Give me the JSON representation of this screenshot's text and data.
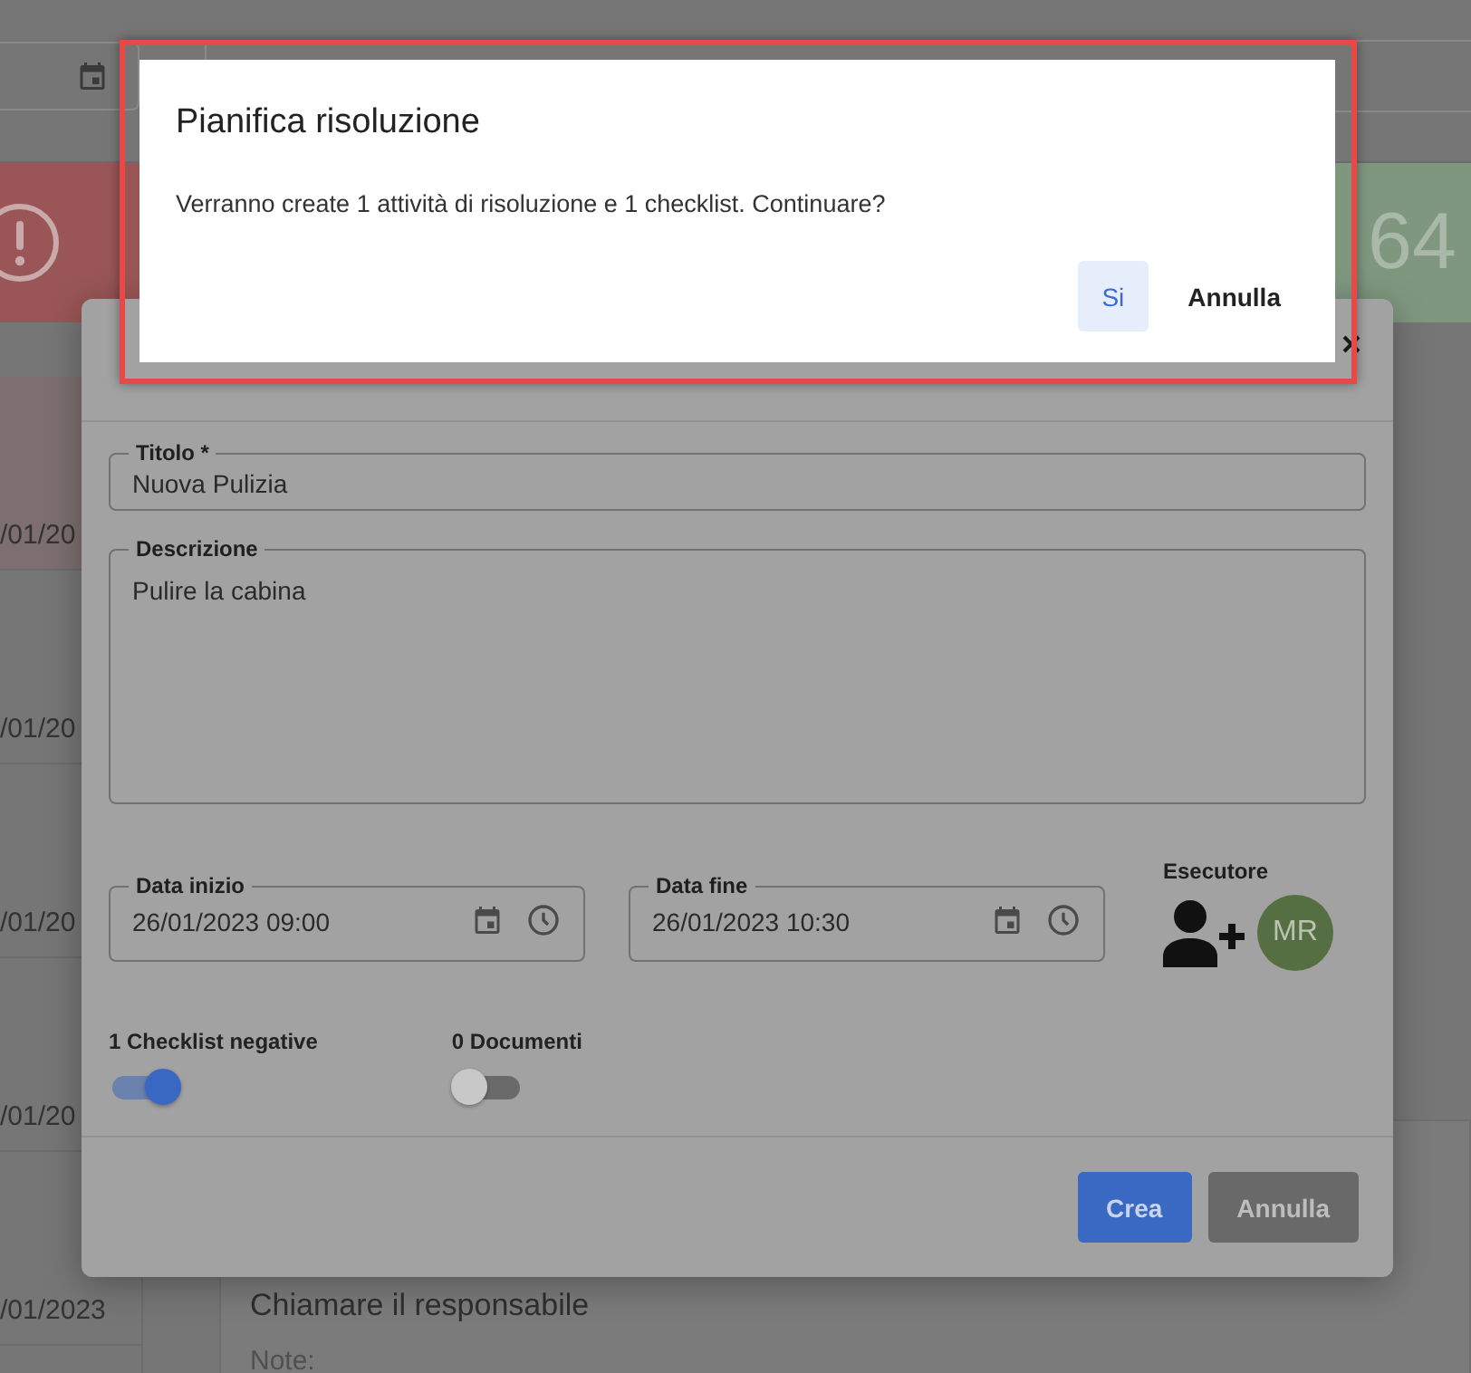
{
  "background": {
    "counter": "64",
    "dates": [
      "/01/20",
      "/01/20",
      "/01/20",
      "/01/20",
      "/01/2023"
    ],
    "task": {
      "title": "Chiamare il responsabile",
      "note_label": "Note:"
    }
  },
  "form_dialog": {
    "title_field": {
      "label": "Titolo *",
      "value": "Nuova Pulizia"
    },
    "description_field": {
      "label": "Descrizione",
      "value": "Pulire la cabina"
    },
    "date_fields": [
      {
        "label": "Data inizio",
        "value": "26/01/2023 09:00"
      },
      {
        "label": "Data fine",
        "value": "26/01/2023 10:30"
      }
    ],
    "executor": {
      "label": "Esecutore",
      "avatar": "MR"
    },
    "toggles": [
      {
        "label": "1 Checklist negative",
        "on": true
      },
      {
        "label": "0 Documenti",
        "on": false
      }
    ],
    "buttons": [
      {
        "label": "Crea",
        "kind": "primary"
      },
      {
        "label": "Annulla",
        "kind": "secondary"
      }
    ]
  },
  "confirm_dialog": {
    "title": "Pianifica risoluzione",
    "message": "Verranno create 1 attività di risoluzione e 1 checklist. Continuare?",
    "buttons": [
      {
        "label": "Si",
        "selected": true
      },
      {
        "label": "Annulla",
        "selected": false
      }
    ]
  }
}
